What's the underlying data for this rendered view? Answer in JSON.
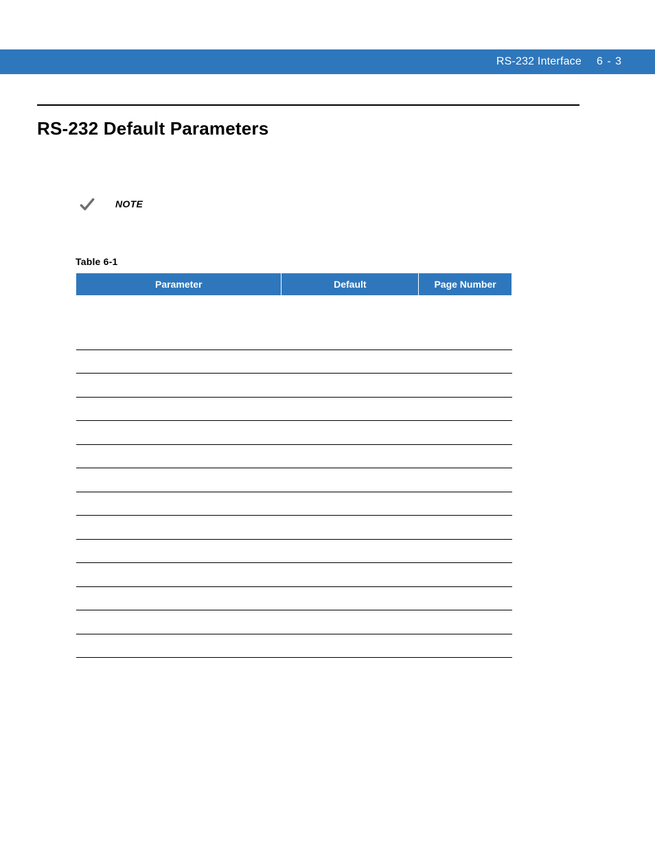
{
  "header": {
    "chapter_title": "RS-232 Interface",
    "page_number": "6 - 3"
  },
  "section": {
    "heading": "RS-232 Default Parameters",
    "note_label": "NOTE",
    "note_body": ""
  },
  "table": {
    "caption": "Table 6-1",
    "columns": {
      "parameter": "Parameter",
      "default": "Default",
      "page_number": "Page Number"
    },
    "section_row_label": "",
    "rows": [
      {
        "parameter": "",
        "default": "",
        "page": ""
      },
      {
        "parameter": "",
        "default": "",
        "page": ""
      },
      {
        "parameter": "",
        "default": "",
        "page": ""
      },
      {
        "parameter": "",
        "default": "",
        "page": ""
      },
      {
        "parameter": "",
        "default": "",
        "page": ""
      },
      {
        "parameter": "",
        "default": "",
        "page": ""
      },
      {
        "parameter": "",
        "default": "",
        "page": ""
      },
      {
        "parameter": "",
        "default": "",
        "page": ""
      },
      {
        "parameter": "",
        "default": "",
        "page": ""
      },
      {
        "parameter": "",
        "default": "",
        "page": ""
      },
      {
        "parameter": "",
        "default": "",
        "page": ""
      },
      {
        "parameter": "",
        "default": "",
        "page": ""
      },
      {
        "parameter": "",
        "default": "",
        "page": ""
      },
      {
        "parameter": "",
        "default": "",
        "page": ""
      }
    ]
  }
}
